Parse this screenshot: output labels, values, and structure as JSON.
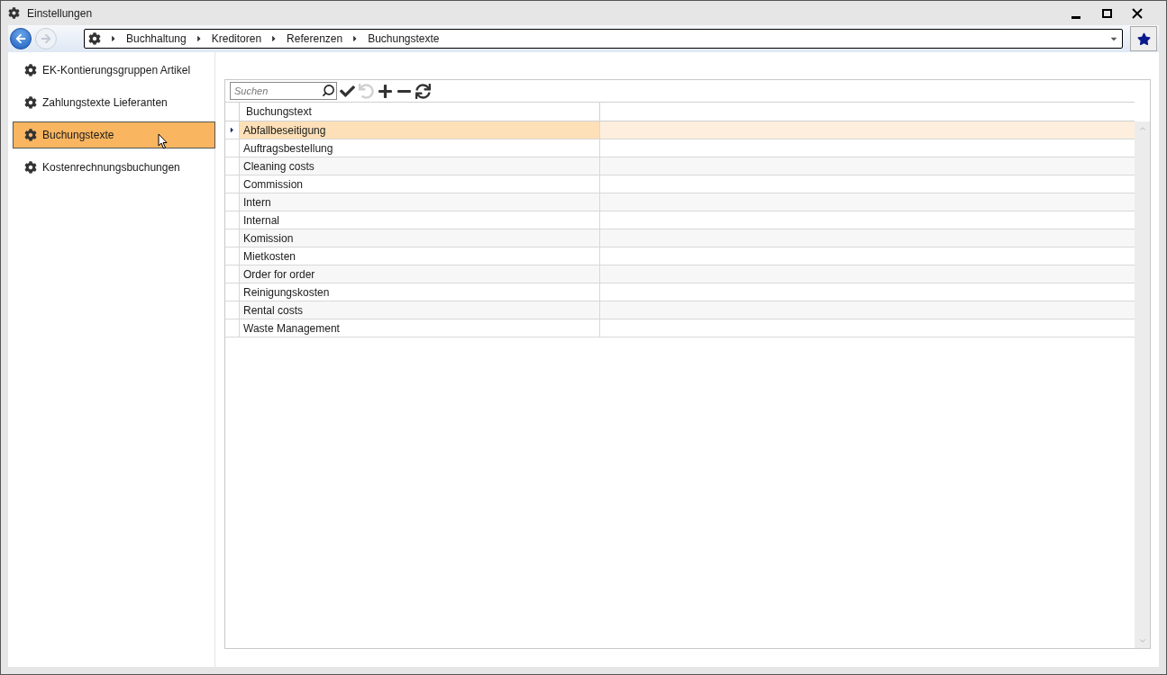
{
  "window": {
    "title": "Einstellungen"
  },
  "nav": {
    "back_disabled": false,
    "forward_disabled": true
  },
  "breadcrumb": [
    "Buchhaltung",
    "Kreditoren",
    "Referenzen",
    "Buchungstexte"
  ],
  "sidebar": {
    "items": [
      {
        "label": "EK-Kontierungsgruppen Artikel",
        "selected": false
      },
      {
        "label": "Zahlungstexte Lieferanten",
        "selected": false
      },
      {
        "label": "Buchungstexte",
        "selected": true
      },
      {
        "label": "Kostenrechnungsbuchungen",
        "selected": false
      }
    ]
  },
  "search": {
    "placeholder": "Suchen"
  },
  "toolbar": [
    {
      "kind": "save",
      "disabled": false
    },
    {
      "kind": "undo",
      "disabled": true
    },
    {
      "kind": "add",
      "disabled": false
    },
    {
      "kind": "remove",
      "disabled": false
    },
    {
      "kind": "refresh",
      "disabled": false
    }
  ],
  "table": {
    "columns": [
      "Buchungstext"
    ],
    "rows": [
      {
        "text": "Abfallbeseitigung",
        "selected": true
      },
      {
        "text": "Auftragsbestellung",
        "selected": false
      },
      {
        "text": "Cleaning costs",
        "selected": false
      },
      {
        "text": "Commission",
        "selected": false
      },
      {
        "text": "Intern",
        "selected": false
      },
      {
        "text": "Internal",
        "selected": false
      },
      {
        "text": "Komission",
        "selected": false
      },
      {
        "text": "Mietkosten",
        "selected": false
      },
      {
        "text": "Order for order",
        "selected": false
      },
      {
        "text": "Reinigungskosten",
        "selected": false
      },
      {
        "text": "Rental costs",
        "selected": false
      },
      {
        "text": "Waste Management",
        "selected": false
      }
    ]
  }
}
